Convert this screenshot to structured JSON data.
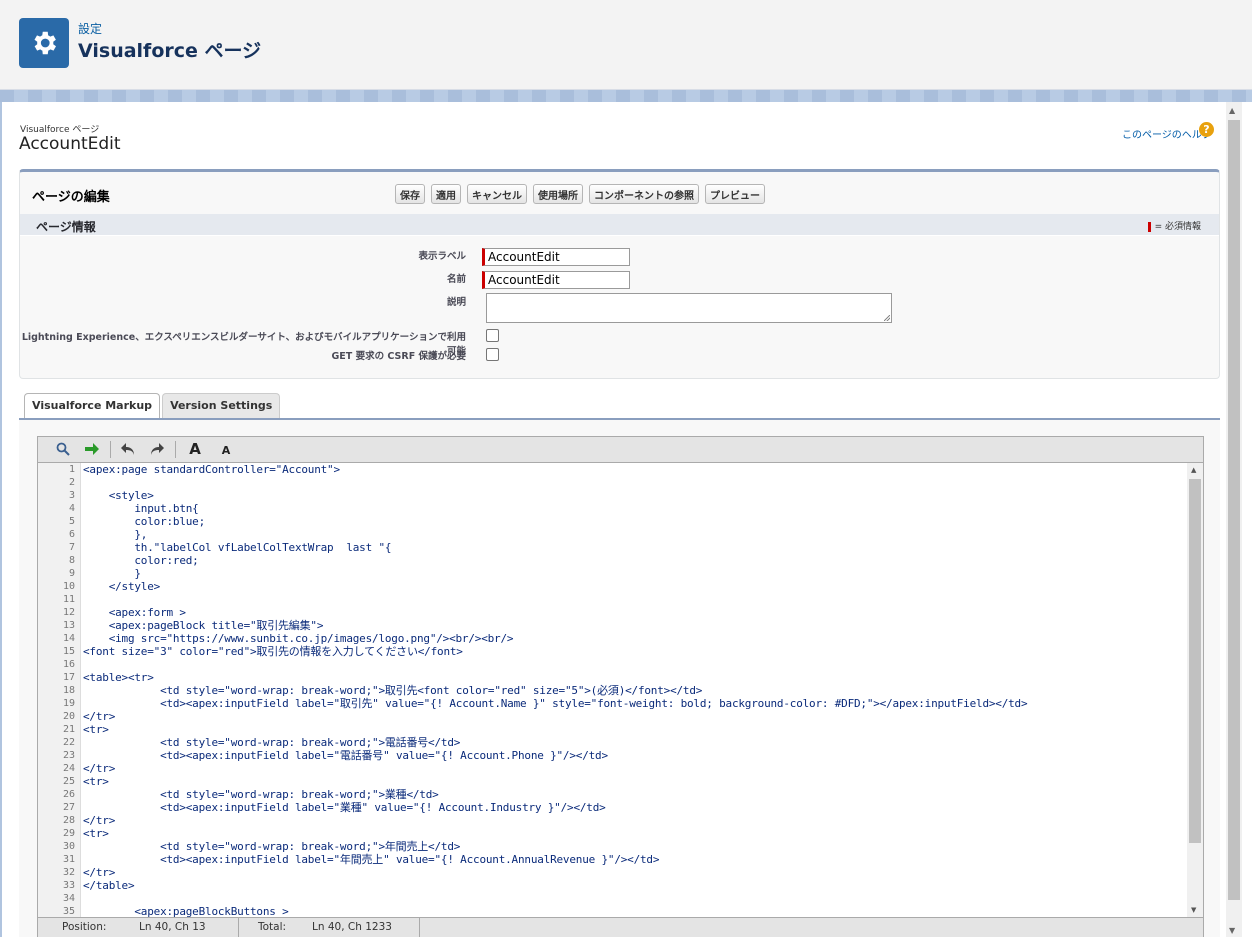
{
  "header": {
    "breadcrumb": "設定",
    "title": "Visualforce ページ",
    "icon": "gear-icon"
  },
  "page": {
    "kicker": "Visualforce ページ",
    "name": "AccountEdit",
    "help_link": "このページのヘルプ",
    "help_icon": "?"
  },
  "edit": {
    "title": "ページの編集",
    "buttons": {
      "save": "保存",
      "apply": "適用",
      "cancel": "キャンセル",
      "where_used": "使用場所",
      "components": "コンポーネントの参照",
      "preview": "プレビュー"
    },
    "section_title": "ページ情報",
    "required_legend": "= 必須情報",
    "fields": {
      "label_label": "表示ラベル",
      "label_value": "AccountEdit",
      "name_label": "名前",
      "name_value": "AccountEdit",
      "description_label": "説明",
      "description_value": "",
      "lightning_label": "Lightning Experience、エクスペリエンスビルダーサイト、およびモバイルアプリケーションで利用可能",
      "lightning_checked": false,
      "csrf_label": "GET 要求の CSRF 保護が必要",
      "csrf_checked": false
    }
  },
  "tabs": [
    {
      "label": "Visualforce Markup",
      "active": true
    },
    {
      "label": "Version Settings",
      "active": false
    }
  ],
  "editor": {
    "toolbar": [
      "search-icon",
      "goto-line-icon",
      "undo-icon",
      "redo-icon",
      "font-increase-icon",
      "font-decrease-icon"
    ],
    "font_large": "A",
    "font_small": "A",
    "lines": [
      "<apex:page standardController=\"Account\">",
      "",
      "    <style>",
      "        input.btn{",
      "        color:blue;",
      "        },",
      "        th.\"labelCol vfLabelColTextWrap  last \"{",
      "        color:red;",
      "        }",
      "    </style>",
      "",
      "    <apex:form >",
      "    <apex:pageBlock title=\"取引先編集\">",
      "    <img src=\"https://www.sunbit.co.jp/images/logo.png\"/><br/><br/>",
      "<font size=\"3\" color=\"red\">取引先の情報を入力してください</font>",
      "",
      "<table><tr>",
      "            <td style=\"word-wrap: break-word;\">取引先<font color=\"red\" size=\"5\">(必須)</font></td>",
      "            <td><apex:inputField label=\"取引先\" value=\"{! Account.Name }\" style=\"font-weight: bold; background-color: #DFD;\"></apex:inputField></td>",
      "</tr>",
      "<tr>",
      "            <td style=\"word-wrap: break-word;\">電話番号</td>",
      "            <td><apex:inputField label=\"電話番号\" value=\"{! Account.Phone }\"/></td>",
      "</tr>",
      "<tr>",
      "            <td style=\"word-wrap: break-word;\">業種</td>",
      "            <td><apex:inputField label=\"業種\" value=\"{! Account.Industry }\"/></td>",
      "</tr>",
      "<tr>",
      "            <td style=\"word-wrap: break-word;\">年間売上</td>",
      "            <td><apex:inputField label=\"年間売上\" value=\"{! Account.AnnualRevenue }\"/></td>",
      "</tr>",
      "</table>",
      "",
      "        <apex:pageBlockButtons >"
    ],
    "status": {
      "position_label": "Position:",
      "position_value": "Ln 40, Ch 13",
      "total_label": "Total:",
      "total_value": "Ln 40, Ch 1233"
    }
  },
  "colors": {
    "brand_blue": "#2a6aa8",
    "required_red": "#cc0000",
    "block_border": "#8a9ebe"
  }
}
